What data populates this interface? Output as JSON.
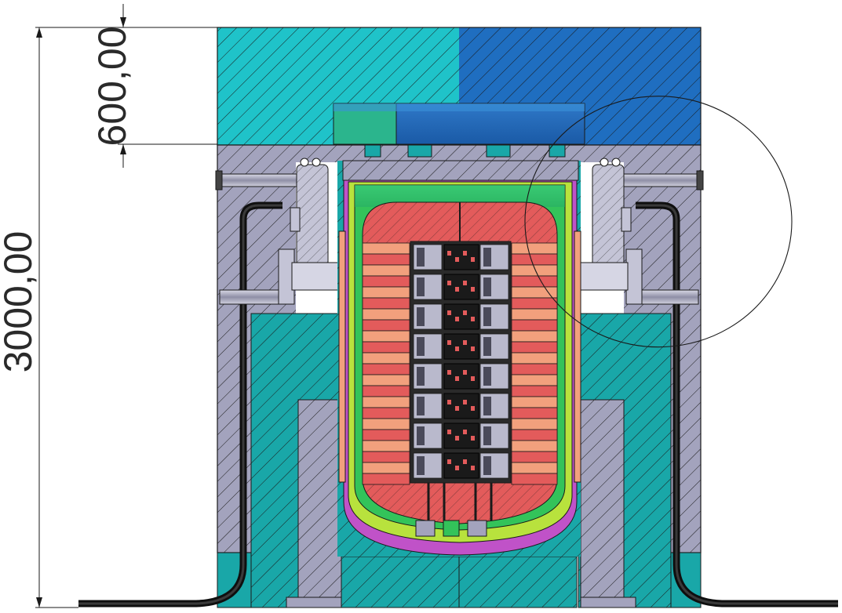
{
  "dimensions": {
    "overall_height": "3000,00",
    "top_height": "600,00"
  },
  "colors": {
    "teal": "#19a7a8",
    "cyan_light": "#1fc3c9",
    "blue": "#1f6ec0",
    "gray_purple": "#a3a3bd",
    "green": "#33c35a",
    "red": "#e35b5b",
    "salmon": "#f2a07d",
    "magenta": "#c052c8",
    "lime": "#b8e23d",
    "black": "#0f0f0f"
  }
}
